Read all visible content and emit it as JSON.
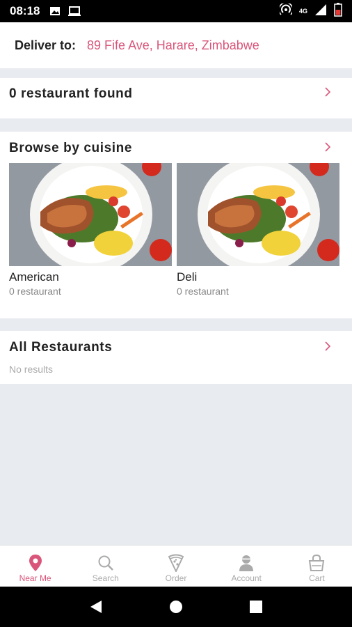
{
  "status_bar": {
    "time": "08:18",
    "network": "4G"
  },
  "deliver": {
    "label": "Deliver to:",
    "address": "89 Fife Ave, Harare, Zimbabwe"
  },
  "restaurants_found": {
    "title": "0 restaurant found"
  },
  "browse": {
    "title": "Browse by cuisine",
    "cuisines": [
      {
        "name": "American",
        "count": "0 restaurant"
      },
      {
        "name": "Deli",
        "count": "0 restaurant"
      }
    ]
  },
  "all_restaurants": {
    "title": "All Restaurants",
    "empty": "No results"
  },
  "tabs": [
    {
      "label": "Near Me",
      "icon": "location-pin-icon",
      "active": true
    },
    {
      "label": "Search",
      "icon": "search-icon",
      "active": false
    },
    {
      "label": "Order",
      "icon": "pizza-icon",
      "active": false
    },
    {
      "label": "Account",
      "icon": "account-icon",
      "active": false
    },
    {
      "label": "Cart",
      "icon": "cart-icon",
      "active": false
    }
  ],
  "colors": {
    "accent": "#d9557a",
    "background": "#e8ebf0"
  }
}
